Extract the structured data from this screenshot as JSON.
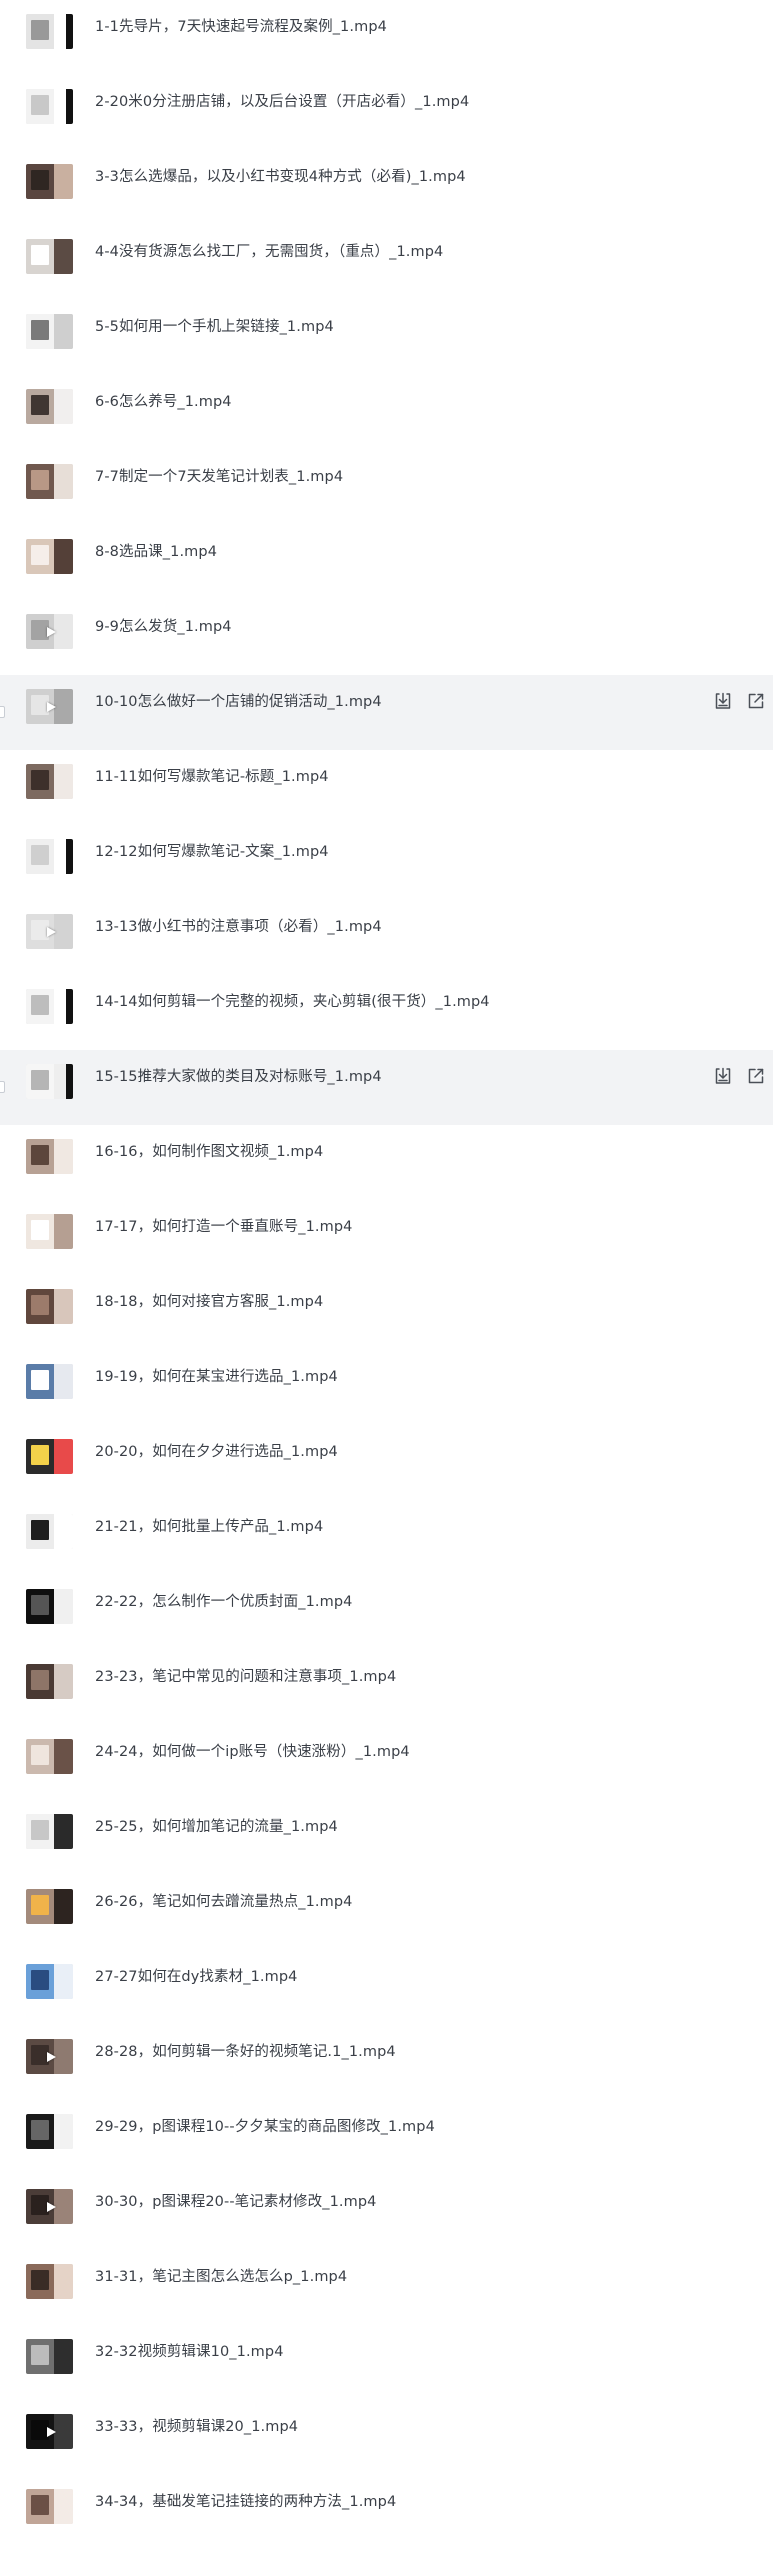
{
  "files": [
    {
      "name": "1-1先导片，7天快速起号流程及案例_1.mp4",
      "thumb": [
        "#e4e4e4",
        "#ffffff",
        "#999999"
      ],
      "edge": true,
      "play": false
    },
    {
      "name": "2-20米0分注册店铺，以及后台设置（开店必看）_1.mp4",
      "thumb": [
        "#f2f2f2",
        "#ffffff",
        "#c8c8c8"
      ],
      "edge": true,
      "play": false
    },
    {
      "name": "3-3怎么选爆品，以及小红书变现4种方式（必看)_1.mp4",
      "thumb": [
        "#5a4640",
        "#c9b0a0",
        "#2f2622"
      ],
      "edge": false,
      "play": false
    },
    {
      "name": "4-4没有货源怎么找工厂，无需囤货，（重点）_1.mp4",
      "thumb": [
        "#d8d4d0",
        "#5b4b44",
        "#ffffff"
      ],
      "edge": false,
      "play": false
    },
    {
      "name": "5-5如何用一个手机上架链接_1.mp4",
      "thumb": [
        "#f3f3f3",
        "#cfcfcf",
        "#7a7a7a"
      ],
      "edge": false,
      "play": false
    },
    {
      "name": "6-6怎么养号_1.mp4",
      "thumb": [
        "#b9a99f",
        "#f1efee",
        "#403632"
      ],
      "edge": false,
      "play": false
    },
    {
      "name": "7-7制定一个7天发笔记计划表_1.mp4",
      "thumb": [
        "#70584e",
        "#e7ded7",
        "#b89886"
      ],
      "edge": false,
      "play": false
    },
    {
      "name": "8-8选品课_1.mp4",
      "thumb": [
        "#d9c7b9",
        "#544038",
        "#f5eeea"
      ],
      "edge": false,
      "play": false
    },
    {
      "name": "9-9怎么发货_1.mp4",
      "thumb": [
        "#cfcfcf",
        "#e8e8e8",
        "#a3a3a3"
      ],
      "edge": false,
      "play": true
    },
    {
      "name": "10-10怎么做好一个店铺的促销活动_1.mp4",
      "thumb": [
        "#d0d0d0",
        "#a9a9a9",
        "#e6e6e6"
      ],
      "edge": false,
      "play": true
    },
    {
      "name": "11-11如何写爆款笔记-标题_1.mp4",
      "thumb": [
        "#7d6a60",
        "#efe9e5",
        "#3d302b"
      ],
      "edge": false,
      "play": false
    },
    {
      "name": "12-12如何写爆款笔记-文案_1.mp4",
      "thumb": [
        "#efefef",
        "#ffffff",
        "#cfcfcf"
      ],
      "edge": true,
      "play": false
    },
    {
      "name": "13-13做小红书的注意事项（必看）_1.mp4",
      "thumb": [
        "#dedede",
        "#d3d3d3",
        "#ebebeb"
      ],
      "edge": false,
      "play": true
    },
    {
      "name": "14-14如何剪辑一个完整的视频，夹心剪辑(很干货）_1.mp4",
      "thumb": [
        "#f4f4f4",
        "#ffffff",
        "#bdbdbd"
      ],
      "edge": true,
      "play": false
    },
    {
      "name": "15-15推荐大家做的类目及对标账号_1.mp4",
      "thumb": [
        "#f6f6f6",
        "#eeeeee",
        "#b5b5b5"
      ],
      "edge": true,
      "play": false
    },
    {
      "name": "16-16，如何制作图文视频_1.mp4",
      "thumb": [
        "#b7a194",
        "#f0e8e2",
        "#5c463c"
      ],
      "edge": false,
      "play": false
    },
    {
      "name": "17-17，如何打造一个垂直账号_1.mp4",
      "thumb": [
        "#efe7e0",
        "#b59f92",
        "#ffffff"
      ],
      "edge": false,
      "play": false
    },
    {
      "name": "18-18，如何对接官方客服_1.mp4",
      "thumb": [
        "#60473d",
        "#d8c6bb",
        "#9c7b6b"
      ],
      "edge": false,
      "play": false
    },
    {
      "name": "19-19，如何在某宝进行选品_1.mp4",
      "thumb": [
        "#5a7ca8",
        "#e6e9ef",
        "#ffffff"
      ],
      "edge": false,
      "play": false
    },
    {
      "name": "20-20，如何在夕夕进行选品_1.mp4",
      "thumb": [
        "#2b2b2b",
        "#e84a4a",
        "#f3d14a"
      ],
      "edge": false,
      "play": false
    },
    {
      "name": "21-21，如何批量上传产品_1.mp4",
      "thumb": [
        "#ececec",
        "#ffffff",
        "#1e1e1e"
      ],
      "edge": false,
      "play": false
    },
    {
      "name": "22-22，怎么制作一个优质封面_1.mp4",
      "thumb": [
        "#0f0f0f",
        "#f0f0f0",
        "#555555"
      ],
      "edge": false,
      "play": false
    },
    {
      "name": "23-23，笔记中常见的问题和注意事项_1.mp4",
      "thumb": [
        "#4a3a34",
        "#d6cbc4",
        "#8e7568"
      ],
      "edge": false,
      "play": false
    },
    {
      "name": "24-24，如何做一个ip账号（快速涨粉）_1.mp4",
      "thumb": [
        "#cbb9ae",
        "#6a5248",
        "#efe5de"
      ],
      "edge": false,
      "play": false
    },
    {
      "name": "25-25，如何增加笔记的流量_1.mp4",
      "thumb": [
        "#f2f2f2",
        "#2a2a2a",
        "#c7c7c7"
      ],
      "edge": false,
      "play": false
    },
    {
      "name": "26-26，笔记如何去蹭流量热点_1.mp4",
      "thumb": [
        "#a38a7b",
        "#2d2420",
        "#f0b34a"
      ],
      "edge": false,
      "play": false
    },
    {
      "name": "27-27如何在dy找素材_1.mp4",
      "thumb": [
        "#6aa0d9",
        "#e9eff7",
        "#2a4c80"
      ],
      "edge": false,
      "play": false
    },
    {
      "name": "28-28，如何剪辑一条好的视频笔记.1_1.mp4",
      "thumb": [
        "#5b4a43",
        "#8e7a70",
        "#3a2e2a"
      ],
      "edge": false,
      "play": true
    },
    {
      "name": "29-29，p图课程10--夕夕某宝的商品图修改_1.mp4",
      "thumb": [
        "#1a1a1a",
        "#f2f2f2",
        "#666666"
      ],
      "edge": false,
      "play": false
    },
    {
      "name": "30-30，p图课程20--笔记素材修改_1.mp4",
      "thumb": [
        "#4b3d38",
        "#9a8378",
        "#2a211e"
      ],
      "edge": false,
      "play": true
    },
    {
      "name": "31-31，笔记主图怎么选怎么p_1.mp4",
      "thumb": [
        "#8a6a5a",
        "#e5d3c7",
        "#3a2c26"
      ],
      "edge": false,
      "play": false
    },
    {
      "name": "32-32视频剪辑课10_1.mp4",
      "thumb": [
        "#6f6f6f",
        "#2e2e2e",
        "#bcbcbc"
      ],
      "edge": false,
      "play": false
    },
    {
      "name": "33-33，视频剪辑课20_1.mp4",
      "thumb": [
        "#141414",
        "#3a3a3a",
        "#0a0a0a"
      ],
      "edge": false,
      "play": true
    },
    {
      "name": "34-34，基础发笔记挂链接的两种方法_1.mp4",
      "thumb": [
        "#c0a597",
        "#f3ebe6",
        "#6b5046"
      ],
      "edge": false,
      "play": false
    }
  ],
  "highlighted_rows": [
    9,
    14
  ],
  "icons": {
    "download": "download-icon",
    "share": "share-external-icon"
  },
  "colors": {
    "row_hover": "#f2f3f5",
    "text": "#3a3f47",
    "icon": "#4a4f57"
  }
}
